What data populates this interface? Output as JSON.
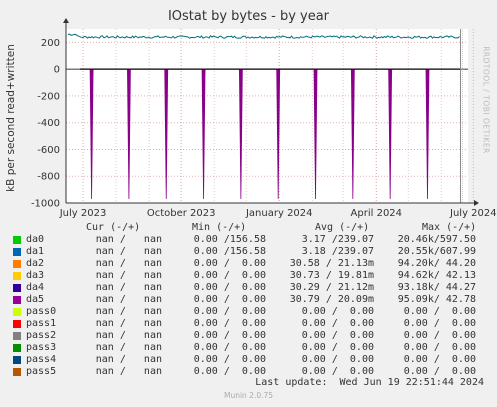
{
  "title": "IOstat by bytes - by year",
  "side_text": "RRDTOOL / TOBI OETIKER",
  "chart_data": {
    "type": "line",
    "title": "IOstat by bytes - by year",
    "ylabel": "kB per second read+written",
    "ylim": [
      -1000,
      300
    ],
    "yticks": [
      200,
      0,
      -200,
      -400,
      -600,
      -800,
      -1000
    ],
    "xlim": [
      "2023-06-15",
      "2024-06-26"
    ],
    "xticks": [
      {
        "label": "July 2023",
        "date": "2023-07-01"
      },
      {
        "label": "October 2023",
        "date": "2023-10-01"
      },
      {
        "label": "January 2024",
        "date": "2024-01-01"
      },
      {
        "label": "April 2024",
        "date": "2024-04-01"
      },
      {
        "label": "July 2024",
        "date": "2024-07-01"
      }
    ],
    "grid": true,
    "series": [
      {
        "name": "da5 (write)",
        "color": "#00707a",
        "approx_value": 240
      },
      {
        "name": "da5 (read)",
        "color": "#8a008a",
        "approx_value": 0,
        "spikes_dates": [
          "2023-07-09",
          "2023-08-13",
          "2023-09-17",
          "2023-10-22",
          "2023-11-26",
          "2023-12-31",
          "2024-02-04",
          "2024-03-10",
          "2024-04-14",
          "2024-05-19"
        ],
        "spike_value": -970
      }
    ],
    "now_marker": "2024-06-19"
  },
  "legend": {
    "headers": {
      "cur": "Cur (-/+)",
      "min": "Min (-/+)",
      "avg": "Avg (-/+)",
      "max": "Max (-/+)"
    },
    "rows": [
      {
        "name": "da0",
        "color": "#00cc00",
        "cur": "nan /   nan",
        "min": "0.00 /156.58",
        "avg": "3.17 /239.07",
        "max": "20.46k/597.50"
      },
      {
        "name": "da1",
        "color": "#0066b3",
        "cur": "nan /   nan",
        "min": "0.00 /156.58",
        "avg": "3.18 /239.07",
        "max": "20.55k/607.99"
      },
      {
        "name": "da2",
        "color": "#ff8000",
        "cur": "nan /   nan",
        "min": "0.00 /  0.00",
        "avg": "30.58 / 21.13m",
        "max": "94.20k/ 44.20"
      },
      {
        "name": "da3",
        "color": "#ffcc00",
        "cur": "nan /   nan",
        "min": "0.00 /  0.00",
        "avg": "30.73 / 19.81m",
        "max": "94.62k/ 42.13"
      },
      {
        "name": "da4",
        "color": "#330099",
        "cur": "nan /   nan",
        "min": "0.00 /  0.00",
        "avg": "30.29 / 21.12m",
        "max": "93.18k/ 44.27"
      },
      {
        "name": "da5",
        "color": "#990099",
        "cur": "nan /   nan",
        "min": "0.00 /  0.00",
        "avg": "30.79 / 20.09m",
        "max": "95.09k/ 42.78"
      },
      {
        "name": "pass0",
        "color": "#ccff00",
        "cur": "nan /   nan",
        "min": "0.00 /  0.00",
        "avg": "0.00 /  0.00",
        "max": "0.00 /  0.00"
      },
      {
        "name": "pass1",
        "color": "#ff0000",
        "cur": "nan /   nan",
        "min": "0.00 /  0.00",
        "avg": "0.00 /  0.00",
        "max": "0.00 /  0.00"
      },
      {
        "name": "pass2",
        "color": "#808080",
        "cur": "nan /   nan",
        "min": "0.00 /  0.00",
        "avg": "0.00 /  0.00",
        "max": "0.00 /  0.00"
      },
      {
        "name": "pass3",
        "color": "#008f00",
        "cur": "nan /   nan",
        "min": "0.00 /  0.00",
        "avg": "0.00 /  0.00",
        "max": "0.00 /  0.00"
      },
      {
        "name": "pass4",
        "color": "#00487d",
        "cur": "nan /   nan",
        "min": "0.00 /  0.00",
        "avg": "0.00 /  0.00",
        "max": "0.00 /  0.00"
      },
      {
        "name": "pass5",
        "color": "#b35a00",
        "cur": "nan /   nan",
        "min": "0.00 /  0.00",
        "avg": "0.00 /  0.00",
        "max": "0.00 /  0.00"
      }
    ]
  },
  "last_update": "Last update:  Wed Jun 19 22:51:44 2024",
  "generator": "Munin 2.0.75"
}
